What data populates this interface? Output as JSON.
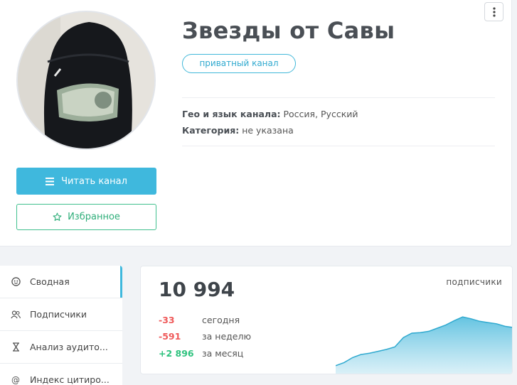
{
  "channel": {
    "title": "Звезды от Савы",
    "badge": "приватный канал",
    "geo_label": "Гео и язык канала:",
    "geo_value": " Россия, Русский",
    "category_label": "Категория:",
    "category_value": " не указана"
  },
  "actions": {
    "read_label": "Читать канал",
    "favorite_label": "Избранное"
  },
  "sidebar": {
    "items": [
      {
        "label": "Сводная",
        "icon": "summary-icon",
        "active": true
      },
      {
        "label": "Подписчики",
        "icon": "subscribers-icon"
      },
      {
        "label": "Анализ аудито...",
        "icon": "hourglass-icon"
      },
      {
        "label": "Индекс цитиро...",
        "icon": "at-icon"
      }
    ]
  },
  "stats": {
    "total": "10 994",
    "total_label": "подписчики",
    "rows": [
      {
        "value": "-33",
        "period": "сегодня",
        "trend": "down"
      },
      {
        "value": "-591",
        "period": "за неделю",
        "trend": "down"
      },
      {
        "value": "+2 896",
        "period": "за месяц",
        "trend": "up"
      }
    ]
  },
  "colors": {
    "accent": "#3fb8dd",
    "favorite": "#41c08e",
    "negative": "#ef5a5a",
    "positive": "#2ec27e"
  },
  "chart_data": {
    "type": "area",
    "series": [
      {
        "values": [
          0.15,
          0.2,
          0.28,
          0.33,
          0.35,
          0.38,
          0.41,
          0.45,
          0.6,
          0.67,
          0.68,
          0.7,
          0.75,
          0.8,
          0.87,
          0.93,
          0.9,
          0.86,
          0.84,
          0.82,
          0.78,
          0.76
        ]
      }
    ],
    "xlabel": "",
    "ylabel": "",
    "grid": false,
    "legend": "none"
  }
}
